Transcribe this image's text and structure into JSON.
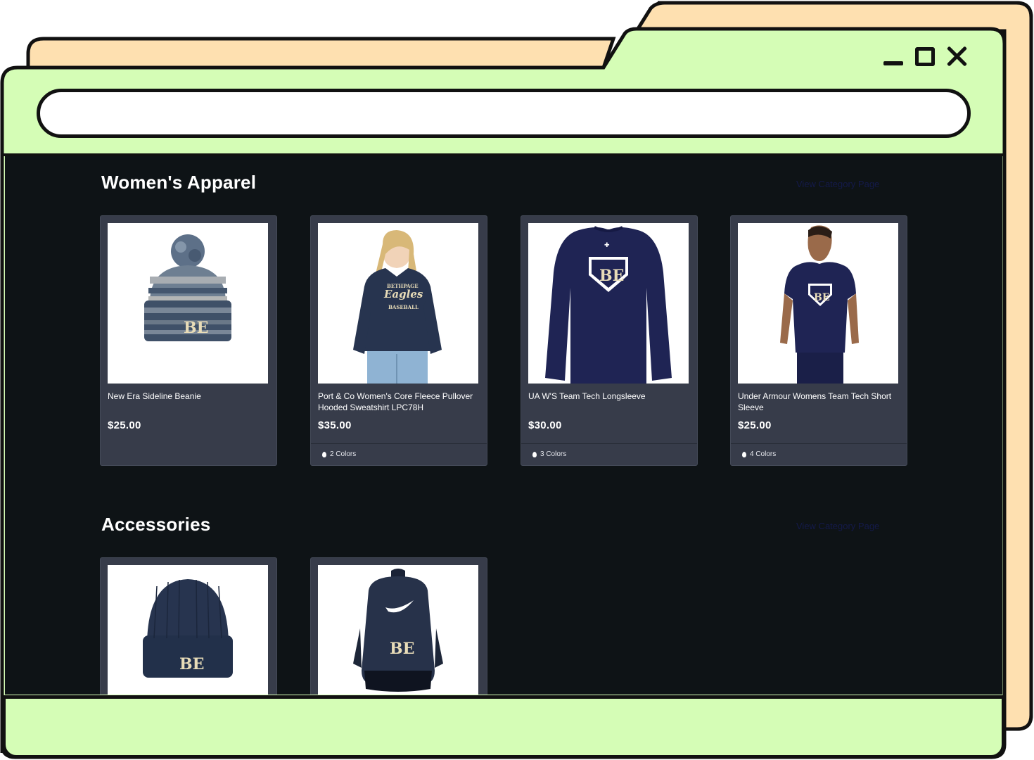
{
  "colors": {
    "frame_green": "#d5fdb6",
    "frame_peach": "#fee0b0",
    "outline": "#111111",
    "content_bg": "#0e1316",
    "card_bg": "#373c4a",
    "navy": "#1e2a4a",
    "gold": "#e8dcb8"
  },
  "window": {
    "controls": [
      "minimize-icon",
      "maximize-icon",
      "close-icon"
    ],
    "address": ""
  },
  "sections": [
    {
      "title": "Women's Apparel",
      "link": "View Category Page",
      "products": [
        {
          "name": "New Era Sideline Beanie",
          "price": "$25.00",
          "colors": "",
          "image": "beanie-pompom-image"
        },
        {
          "name": "Port & Co Women's Core Fleece Pullover Hooded Sweatshirt LPC78H",
          "price": "$35.00",
          "colors": "2 Colors",
          "image": "hoodie-image",
          "print_line1": "BETHPAGE",
          "print_line2": "Eagles",
          "print_line3": "BASEBALL"
        },
        {
          "name": "UA W'S Team Tech Longsleeve",
          "price": "$30.00",
          "colors": "3 Colors",
          "image": "longsleeve-image"
        },
        {
          "name": "Under Armour Womens Team Tech Short Sleeve",
          "price": "$25.00",
          "colors": "4 Colors",
          "image": "shortsleeve-image"
        }
      ]
    },
    {
      "title": "Accessories",
      "link": "View Category Page",
      "products": [
        {
          "image": "knit-beanie-image"
        },
        {
          "image": "backpack-image"
        }
      ]
    }
  ],
  "logo_letters": "BE"
}
